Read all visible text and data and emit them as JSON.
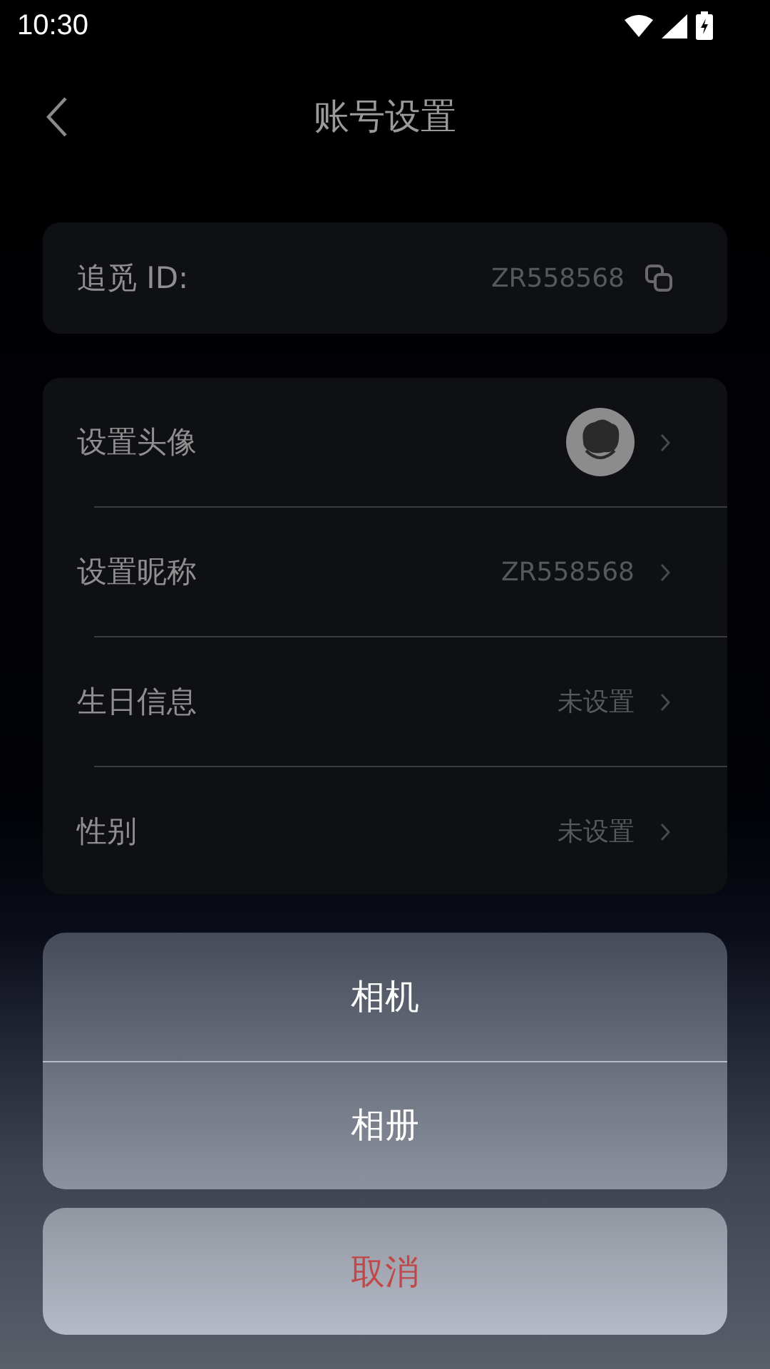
{
  "status_bar": {
    "time": "10:30"
  },
  "header": {
    "title": "账号设置"
  },
  "id_card": {
    "label": "追觅 ID:",
    "value": "ZR558568"
  },
  "settings": [
    {
      "kind": "avatar",
      "label": "设置头像"
    },
    {
      "kind": "value",
      "label": "设置昵称",
      "value": "ZR558568"
    },
    {
      "kind": "value",
      "label": "生日信息",
      "value": "未设置"
    },
    {
      "kind": "value",
      "label": "性别",
      "value": "未设置"
    }
  ],
  "action_sheet": {
    "options": [
      "相机",
      "相册"
    ],
    "cancel": "取消"
  }
}
